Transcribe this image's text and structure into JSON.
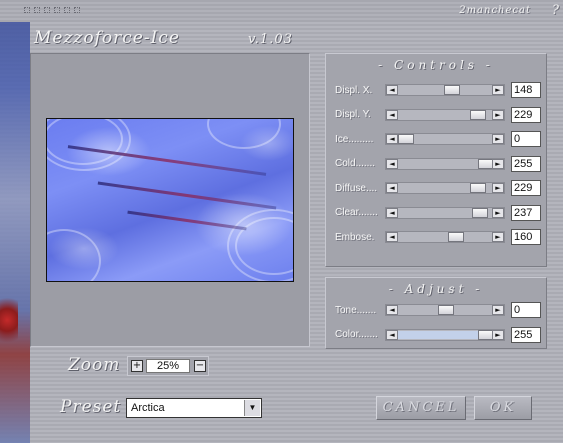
{
  "window": {
    "author": "2manchecat",
    "help": "?",
    "app_title": "Mezzoforce-Ice",
    "version": "v.1.03"
  },
  "controls_panel": {
    "title": "Controls",
    "sliders": [
      {
        "label": "Displ. X.",
        "value": "148",
        "level": 0.58
      },
      {
        "label": "Displ. Y.",
        "value": "229",
        "level": 0.9
      },
      {
        "label": "Ice.........",
        "value": "0",
        "level": 0.0
      },
      {
        "label": "Cold.......",
        "value": "255",
        "level": 1.0
      },
      {
        "label": "Diffuse....",
        "value": "229",
        "level": 0.9
      },
      {
        "label": "Clear.......",
        "value": "237",
        "level": 0.93
      },
      {
        "label": "Embose.",
        "value": "160",
        "level": 0.63
      }
    ]
  },
  "adjust_panel": {
    "title": "Adjust",
    "sliders": [
      {
        "label": "Tone.......",
        "value": "0",
        "level": 0.5
      },
      {
        "label": "Color.......",
        "value": "255",
        "level": 1.0
      }
    ]
  },
  "zoom": {
    "label": "Zoom",
    "value": "25%",
    "plus": "+",
    "minus": "−"
  },
  "preset": {
    "label": "Preset",
    "selected": "Arctica"
  },
  "buttons": {
    "cancel": "CANCEL",
    "ok": "OK"
  },
  "colors": {
    "preview_blue": "#6b7df0",
    "slider_fill": "#c3d1ea"
  }
}
